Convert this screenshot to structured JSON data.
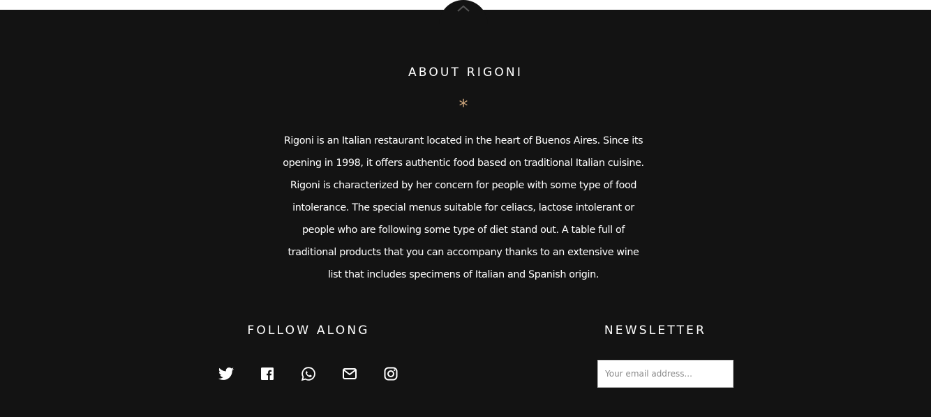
{
  "footer": {
    "scroll_top_icon": "chevron-up-icon",
    "about": {
      "title": "ABOUT RIGONI",
      "ornament": "*",
      "text": "Rigoni is an Italian restaurant located in the heart of Buenos Aires. Since its opening in 1998, it offers authentic food based on traditional Italian cuisine. Rigoni is characterized by her concern for people with some type of food intolerance. The special menus suitable for celiacs, lactose intolerant or people who are following some type of diet stand out. A table full of traditional products that you can accompany thanks to an extensive wine list that includes specimens of Italian and Spanish origin."
    },
    "follow": {
      "title": "FOLLOW ALONG",
      "icons": [
        "twitter-icon",
        "facebook-icon",
        "whatsapp-icon",
        "email-icon",
        "instagram-icon"
      ]
    },
    "newsletter": {
      "title": "NEWSLETTER",
      "email_placeholder": "Your email address...",
      "email_value": ""
    }
  },
  "colors": {
    "background": "#131313",
    "text": "#ffffff",
    "accent": "#c8a27a"
  }
}
